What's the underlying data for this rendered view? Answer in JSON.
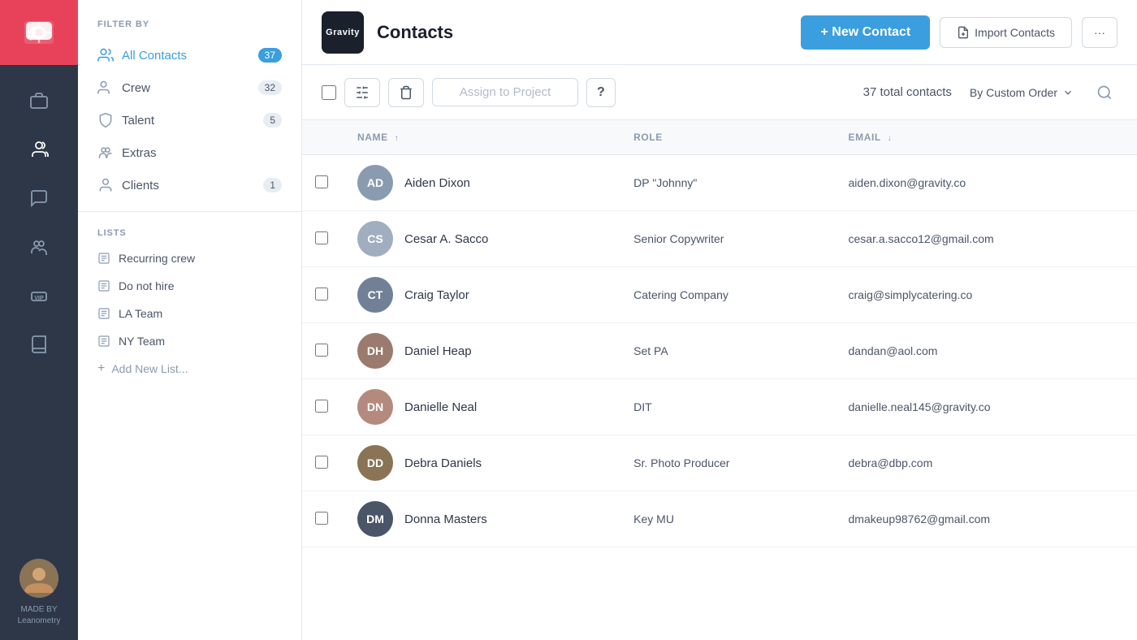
{
  "app": {
    "logo_text": "Gravity",
    "page_title": "Contacts"
  },
  "header": {
    "new_contact_label": "+ New Contact",
    "import_label": "Import Contacts",
    "more_label": "···"
  },
  "toolbar": {
    "assign_placeholder": "Assign to Project",
    "total_contacts": "37 total contacts",
    "sort_label": "By Custom Order",
    "question_mark": "?"
  },
  "sidebar": {
    "filter_label": "FILTER BY",
    "items": [
      {
        "id": "all-contacts",
        "label": "All Contacts",
        "count": "37",
        "active": true
      },
      {
        "id": "crew",
        "label": "Crew",
        "count": "32",
        "active": false
      },
      {
        "id": "talent",
        "label": "Talent",
        "count": "5",
        "active": false
      },
      {
        "id": "extras",
        "label": "Extras",
        "count": "",
        "active": false
      },
      {
        "id": "clients",
        "label": "Clients",
        "count": "1",
        "active": false
      }
    ],
    "lists_label": "LISTS",
    "lists": [
      {
        "id": "recurring-crew",
        "label": "Recurring crew"
      },
      {
        "id": "do-not-hire",
        "label": "Do not hire"
      },
      {
        "id": "la-team",
        "label": "LA Team"
      },
      {
        "id": "ny-team",
        "label": "NY Team"
      }
    ],
    "add_list_label": "Add New List..."
  },
  "table": {
    "columns": [
      {
        "id": "name",
        "label": "NAME",
        "sort": "asc"
      },
      {
        "id": "role",
        "label": "ROLE",
        "sort": ""
      },
      {
        "id": "email",
        "label": "EMAIL",
        "sort": "desc"
      }
    ],
    "rows": [
      {
        "id": "aiden-dixon",
        "name": "Aiden Dixon",
        "role": "DP \"Johnny\"",
        "email": "aiden.dixon@gravity.co",
        "initials": "AD",
        "avatar_color": "#8a9bb0"
      },
      {
        "id": "cesar-sacco",
        "name": "Cesar A. Sacco",
        "role": "Senior Copywriter",
        "email": "cesar.a.sacco12@gmail.com",
        "initials": "CS",
        "avatar_color": "#a0aec0"
      },
      {
        "id": "craig-taylor",
        "name": "Craig Taylor",
        "role": "Catering Company",
        "email": "craig@simplycatering.co",
        "initials": "CT",
        "avatar_color": "#718096"
      },
      {
        "id": "daniel-heap",
        "name": "Daniel Heap",
        "role": "Set PA",
        "email": "dandan@aol.com",
        "initials": "DH",
        "avatar_color": "#9b7b6e"
      },
      {
        "id": "danielle-neal",
        "name": "Danielle Neal",
        "role": "DIT",
        "email": "danielle.neal145@gravity.co",
        "initials": "DN",
        "avatar_color": "#b58a7e"
      },
      {
        "id": "debra-daniels",
        "name": "Debra Daniels",
        "role": "Sr. Photo Producer",
        "email": "debra@dbp.com",
        "initials": "DD",
        "avatar_color": "#8b7355"
      },
      {
        "id": "donna-masters",
        "name": "Donna Masters",
        "role": "Key MU",
        "email": "dmakeup98762@gmail.com",
        "initials": "DM",
        "avatar_color": "#4a5568"
      }
    ]
  },
  "nav_icons": [
    {
      "id": "briefcase",
      "label": "briefcase-icon"
    },
    {
      "id": "contacts",
      "label": "contacts-icon"
    },
    {
      "id": "chat",
      "label": "chat-icon"
    },
    {
      "id": "team",
      "label": "team-icon"
    },
    {
      "id": "vip",
      "label": "vip-icon"
    },
    {
      "id": "book",
      "label": "book-icon"
    }
  ],
  "user": {
    "made_by_label": "MADE BY",
    "company_label": "Leanometry"
  }
}
